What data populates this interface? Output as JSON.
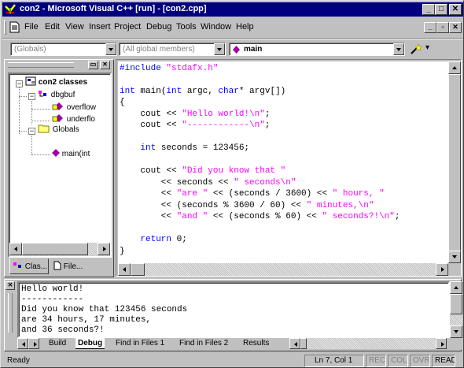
{
  "window": {
    "title": "con2 - Microsoft Visual C++ [run] - [con2.cpp]",
    "minimize": "_",
    "maximize": "□",
    "close": "✕"
  },
  "menu": {
    "items": [
      "File",
      "Edit",
      "View",
      "Insert",
      "Project",
      "Debug",
      "Tools",
      "Window",
      "Help"
    ],
    "mdi_minimize": "_",
    "mdi_restore": "▫",
    "mdi_close": "✕"
  },
  "wizardbar": {
    "scope": "(Globals)",
    "members": "(All global members)",
    "function": "main",
    "action_dropdown": "▾"
  },
  "classview": {
    "root": "con2 classes",
    "class_name": "dbgbuf",
    "member1": "overflow",
    "member2": "underflo",
    "globals": "Globals",
    "global1": "main(int",
    "tab_classes": "Clas...",
    "tab_files": "File..."
  },
  "code": {
    "l1_pp": "#include",
    "l1_str": " \"stdafx.h\"",
    "l3_kw1": "int",
    "l3_a": " main(",
    "l3_kw2": "int",
    "l3_b": " argc, ",
    "l3_kw3": "char",
    "l3_c": "* argv[])",
    "l4": "{",
    "l5_a": "    cout << ",
    "l5_str": "\"Hello world!\\n\"",
    "l5_b": ";",
    "l6_a": "    cout << ",
    "l6_str": "\"------------\\n\"",
    "l6_b": ";",
    "l8_kw": "    int",
    "l8_a": " seconds = 123456;",
    "l10_a": "    cout << ",
    "l10_str": "\"Did you know that \"",
    "l11_a": "        << seconds << ",
    "l11_str": "\" seconds\\n\"",
    "l12_a": "        << ",
    "l12_str1": "\"are \"",
    "l12_b": " << (seconds / 3600) << ",
    "l12_str2": "\" hours, \"",
    "l13_a": "        << (seconds % 3600 / 60) << ",
    "l13_str": "\" minutes,\\n\"",
    "l14_a": "        << ",
    "l14_str1": "\"and \"",
    "l14_b": " << (seconds % 60) << ",
    "l14_str2": "\" seconds?!\\n\"",
    "l14_c": ";",
    "l16_kw": "    return",
    "l16_a": " 0;",
    "l17": "}"
  },
  "output": {
    "lines": [
      "Hello world!",
      "------------",
      "Did you know that 123456 seconds",
      "are 34 hours, 17 minutes,",
      "and 36 seconds?!"
    ],
    "tabs": [
      "Build",
      "Debug",
      "Find in Files 1",
      "Find in Files 2",
      "Results"
    ],
    "active_tab": "Debug"
  },
  "status": {
    "text": "Ready",
    "position": "Ln 7, Col 1",
    "rec": "REC",
    "col": "COL",
    "ovr": "OVR",
    "read": "READ"
  }
}
